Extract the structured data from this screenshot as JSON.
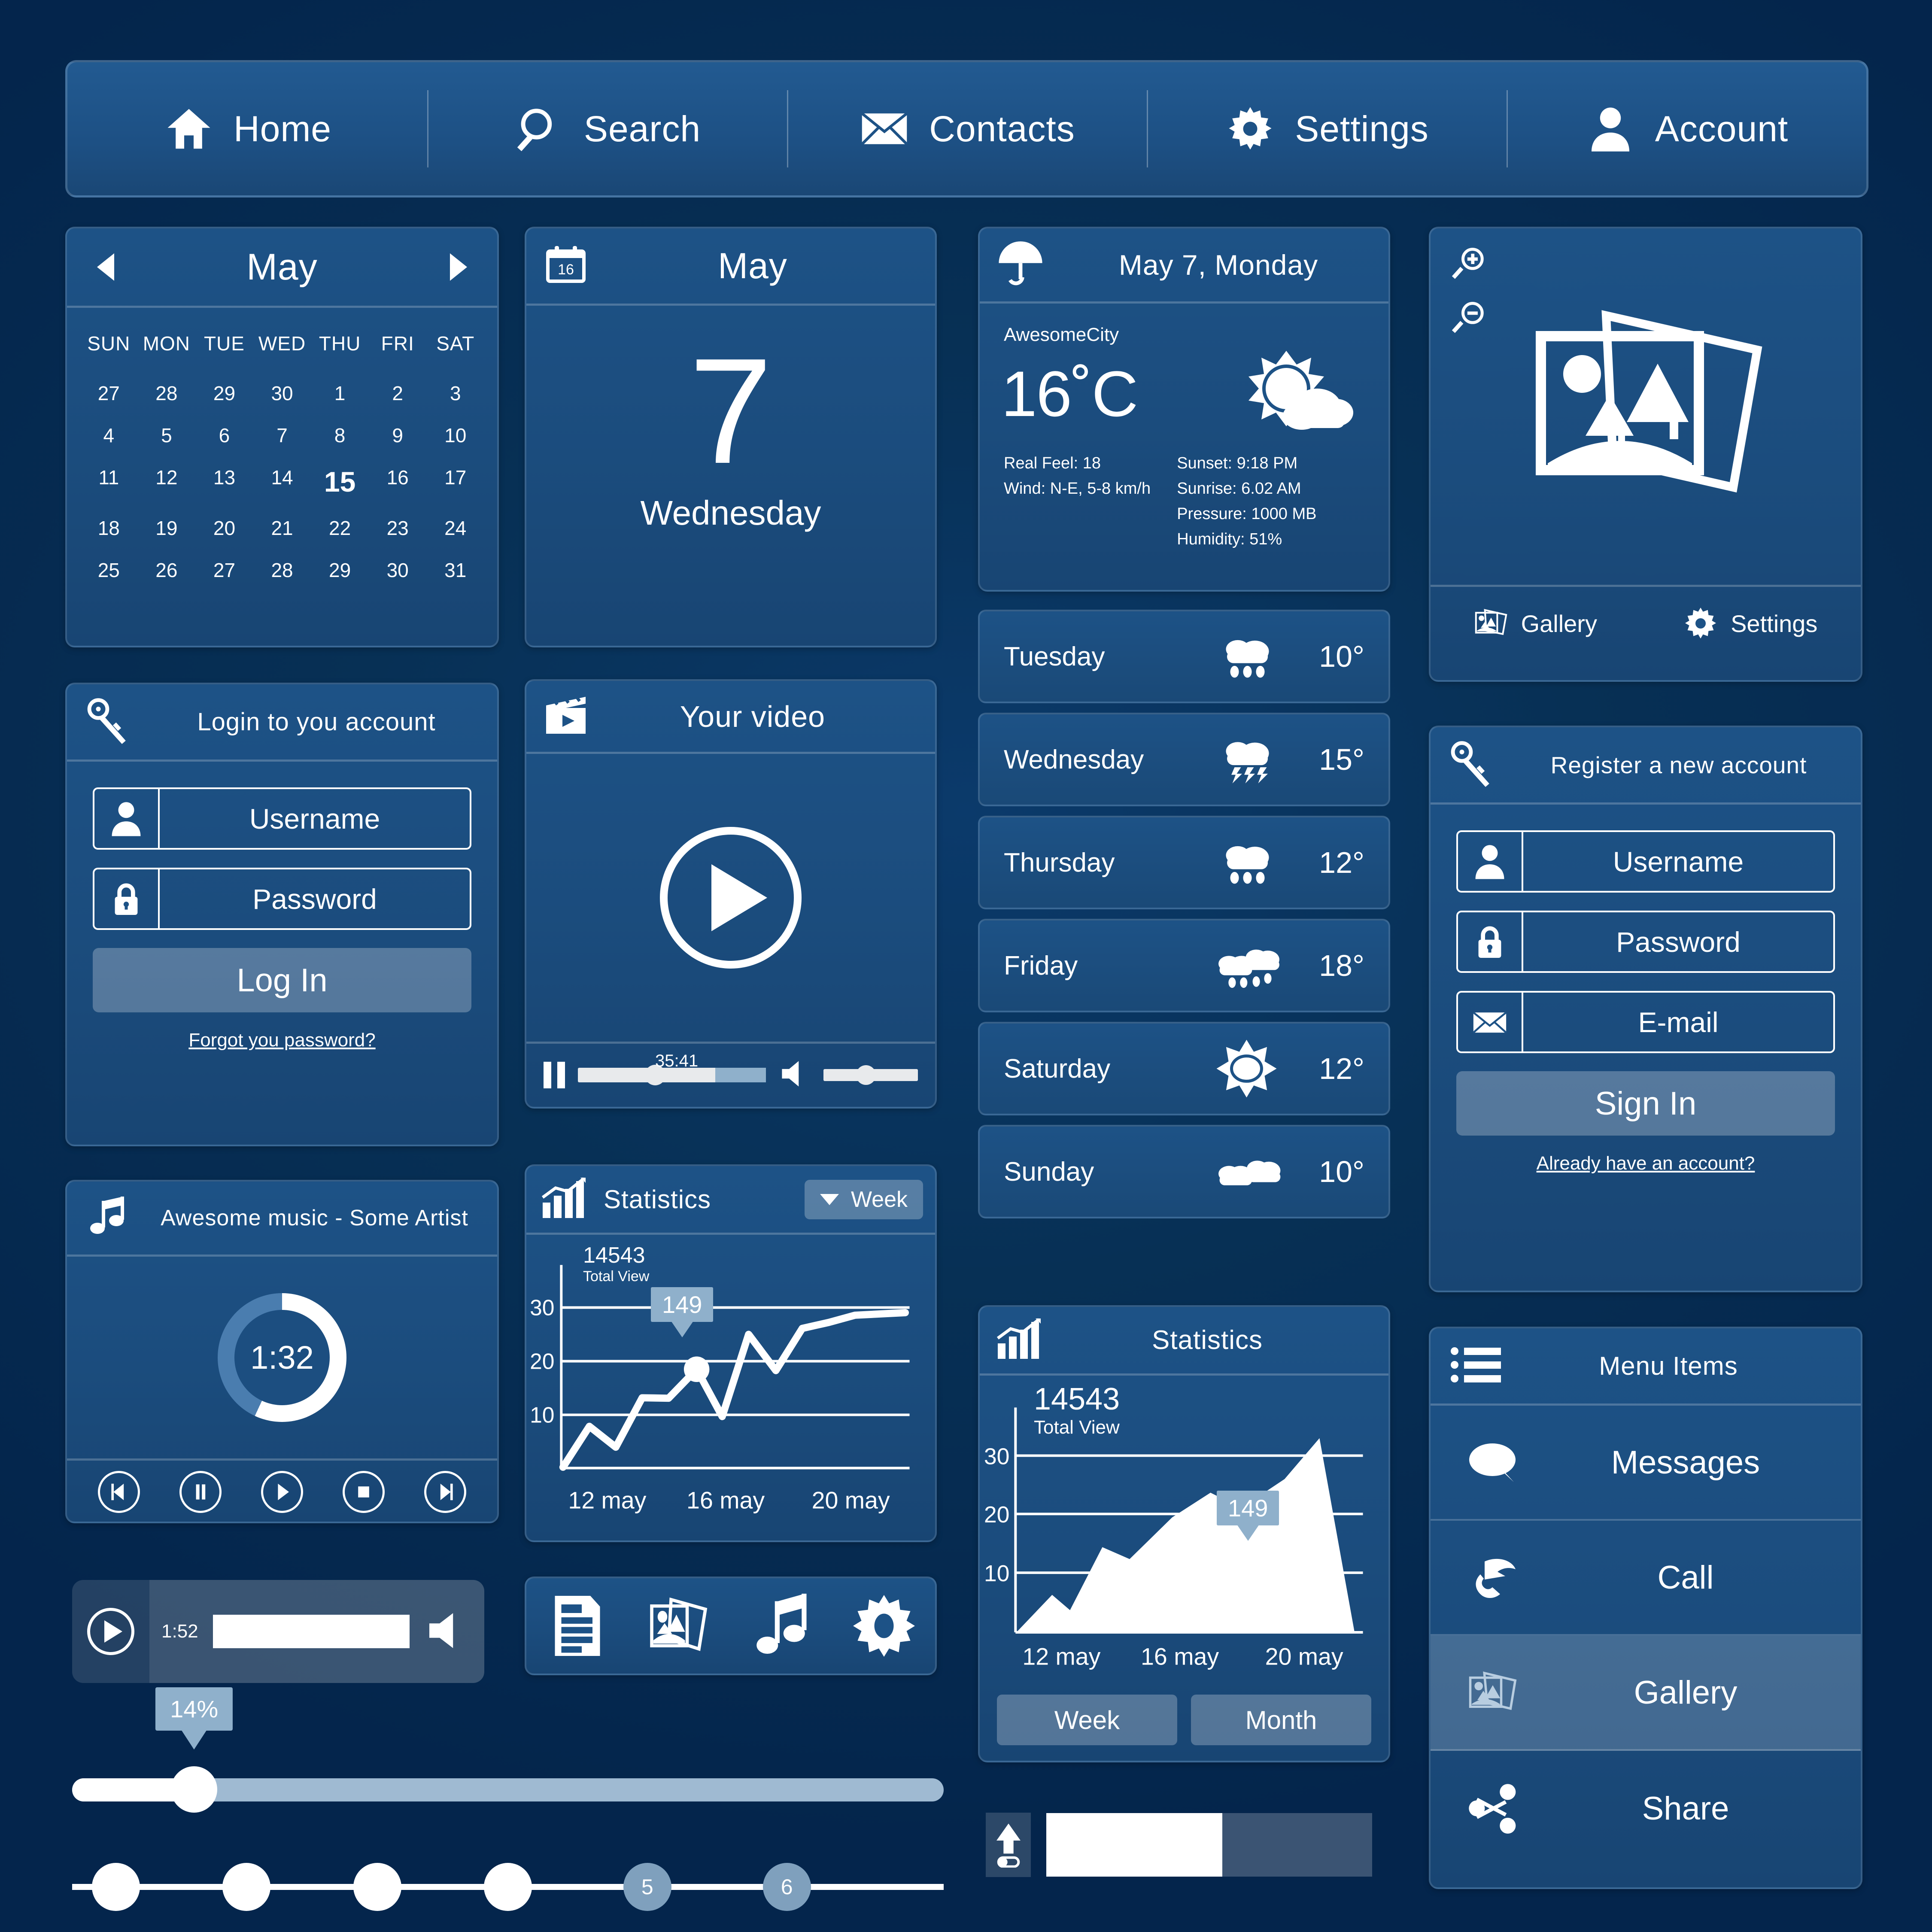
{
  "nav": {
    "items": [
      {
        "label": "Home",
        "icon": "home-icon"
      },
      {
        "label": "Search",
        "icon": "search-icon"
      },
      {
        "label": "Contacts",
        "icon": "envelope-icon"
      },
      {
        "label": "Settings",
        "icon": "gear-icon"
      },
      {
        "label": "Account",
        "icon": "user-icon"
      }
    ]
  },
  "calendar": {
    "month": "May",
    "prev": "◀",
    "next": "▶",
    "weekdays": [
      "SUN",
      "MON",
      "TUE",
      "WED",
      "THU",
      "FRI",
      "SAT"
    ],
    "weeks": [
      [
        "27",
        "28",
        "29",
        "30",
        "1",
        "2",
        "3"
      ],
      [
        "4",
        "5",
        "6",
        "7",
        "8",
        "9",
        "10"
      ],
      [
        "11",
        "12",
        "13",
        "14",
        "15",
        "16",
        "17"
      ],
      [
        "18",
        "19",
        "20",
        "21",
        "22",
        "23",
        "24"
      ],
      [
        "25",
        "26",
        "27",
        "28",
        "29",
        "30",
        "31"
      ]
    ],
    "today": "15"
  },
  "datecard": {
    "month": "May",
    "day": "7",
    "weekday": "Wednesday",
    "icon_badge": "16"
  },
  "login": {
    "title": "Login to you account",
    "username": "Username",
    "password": "Password",
    "button": "Log In",
    "link": "Forgot you password?"
  },
  "register": {
    "title": "Register a new account",
    "username": "Username",
    "password": "Password",
    "email": "E-mail",
    "button": "Sign In",
    "link": "Already have an account?"
  },
  "music": {
    "title": "Awesome music - Some Artist",
    "elapsed": "1:32",
    "progress_pct": 57,
    "controls": [
      "prev",
      "pause",
      "play",
      "stop",
      "next"
    ]
  },
  "video": {
    "title": "Your video",
    "time": "35:41",
    "progress_pct": 41,
    "buffered_pct": 73,
    "volume_pct": 45
  },
  "weather": {
    "header_date": "May 7, Monday",
    "city": "AwesomeCity",
    "temp": "16˚C",
    "real_feel": "Real Feel: 18",
    "wind": "Wind: N-E, 5-8 km/h",
    "sunset": "Sunset: 9:18 PM",
    "sunrise": "Sunrise: 6.02 AM",
    "pressure": "Pressure: 1000 MB",
    "humidity": "Humidity: 51%",
    "forecast": [
      {
        "day": "Tuesday",
        "temp": "10°",
        "icon": "rain-cloud-icon"
      },
      {
        "day": "Wednesday",
        "temp": "15°",
        "icon": "thunderstorm-icon"
      },
      {
        "day": "Thursday",
        "temp": "12°",
        "icon": "rain-cloud-icon"
      },
      {
        "day": "Friday",
        "temp": "18°",
        "icon": "rain-clouds-icon"
      },
      {
        "day": "Saturday",
        "temp": "12°",
        "icon": "sun-icon"
      },
      {
        "day": "Sunday",
        "temp": "10°",
        "icon": "clouds-icon"
      }
    ]
  },
  "gallery": {
    "footer_gallery": "Gallery",
    "footer_settings": "Settings"
  },
  "menu": {
    "title": "Menu Items",
    "items": [
      {
        "label": "Messages",
        "icon": "speech-bubble-icon",
        "active": false
      },
      {
        "label": "Call",
        "icon": "phone-icon",
        "active": false
      },
      {
        "label": "Gallery",
        "icon": "photos-icon",
        "active": true
      },
      {
        "label": "Share",
        "icon": "share-icon",
        "active": false
      }
    ]
  },
  "miniaudio": {
    "time": "1:52"
  },
  "icontools": [
    "document-icon",
    "photos-icon",
    "music-note-icon",
    "gear-icon"
  ],
  "slider": {
    "value_label": "14%",
    "value_pct": 14
  },
  "pager": {
    "dots": [
      "",
      "",
      "",
      "",
      "5",
      "6"
    ]
  },
  "upload": {
    "progress_pct": 54
  },
  "chart_data": [
    {
      "type": "line",
      "title": "Statistics",
      "range_selector": "Week",
      "total_label": "Total View",
      "total_value": "14543",
      "annotation": "149",
      "annotation_index": 5,
      "xlabel": "",
      "ylabel": "",
      "ylim": [
        0,
        35
      ],
      "yticks": [
        10,
        20,
        30
      ],
      "xticks": [
        "12 may",
        "16 may",
        "20 may"
      ],
      "x": [
        0,
        1,
        2,
        3,
        4,
        5,
        6,
        7,
        8,
        9,
        10,
        11,
        12
      ],
      "values": [
        0,
        8,
        4,
        13,
        13,
        18.5,
        11.5,
        25,
        18,
        26,
        27,
        28,
        28
      ],
      "grid": true
    },
    {
      "type": "area",
      "title": "Statistics",
      "total_label": "Total View",
      "total_value": "14543",
      "annotation": "149",
      "buttons": [
        "Week",
        "Month"
      ],
      "xlabel": "",
      "ylabel": "",
      "ylim": [
        0,
        35
      ],
      "yticks": [
        10,
        20,
        30
      ],
      "xticks": [
        "12 may",
        "16 may",
        "20 may"
      ],
      "x": [
        0,
        1,
        2,
        3,
        4,
        5,
        6,
        7,
        8,
        9,
        10
      ],
      "values": [
        0,
        6,
        3,
        14,
        12,
        19,
        25,
        22,
        27,
        31,
        0
      ],
      "grid": true
    }
  ],
  "colors": {
    "background": "#04254c",
    "panel": "#1c4e80",
    "accent": "#8fb0cb",
    "text": "#ffffff"
  }
}
